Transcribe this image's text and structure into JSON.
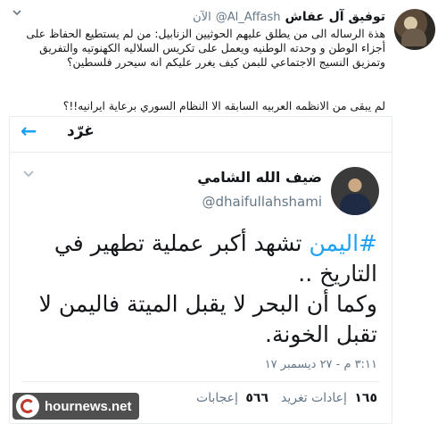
{
  "outer_tweet": {
    "name": "توفيق آل عفاش",
    "handle": "@Al_Affash",
    "time": "الآن",
    "paragraph1": "هذة الرساله الى من يطلق عليهم الحوثيين الزنابيل: من لم يستطيع الحفاظ على أجزاء الوطن و وحدته الوطنيه ويعمل على تكريس السلاليه الكهنوتيه والتفريق وتمزيق النسيج الاجتماعي للبمن كيف يغرر عليكم انه سيحرر فلسطين؟",
    "paragraph2": "لم يبقى من الانظمه العربيه السابقه الا النظام السوري برعاية ايرانيه!!؟",
    "chevron_icon": "chevron-down-icon"
  },
  "embedded": {
    "top_bar": {
      "title": "غرّد",
      "back_icon": "arrow-left-icon",
      "back_glyph": "←"
    },
    "author_name": "ضيف الله الشامي",
    "author_handle": "@dhaifullahshami",
    "hashtag": "#اليمن",
    "body_rest": " تشهد أكبر عملية تطهير في التاريخ ..",
    "body_line2": "وكما أن البحر لا يقبل الميتة فاليمن لا تقبل الخونة.",
    "date": "٣:١١ م - ٢٧ ديسمبر ١٧",
    "stats": [
      {
        "count": "١٦٥",
        "label": "إعادات تغريد"
      },
      {
        "count": "٥٦٦",
        "label": "إعجابات"
      }
    ]
  },
  "watermark": {
    "text": "hournews.net"
  }
}
